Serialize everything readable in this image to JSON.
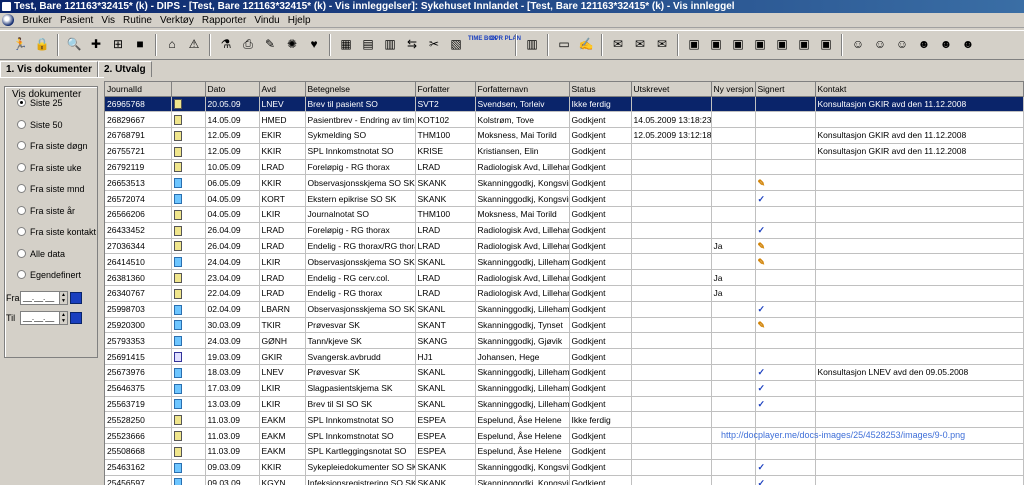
{
  "window": {
    "title": "Test, Bare  121163*32415* (k) - DIPS - [Test, Bare  121163*32415* (k) - Vis innleggelser]: Sykehuset Innlandet - [Test, Bare  121163*32415* (k) - Vis innleggel"
  },
  "menu": [
    "Bruker",
    "Pasient",
    "Vis",
    "Rutine",
    "Verktøy",
    "Rapporter",
    "Vindu",
    "Hjelp"
  ],
  "toolbar": {
    "groups": [
      [
        {
          "icon": "running-person-icon",
          "glyph": "🏃"
        },
        {
          "icon": "lock-icon",
          "glyph": "🔒"
        }
      ],
      [
        {
          "icon": "search-person-icon",
          "glyph": "🔍"
        },
        {
          "icon": "red-cross-icon",
          "glyph": "✚"
        },
        {
          "icon": "flowchart-icon",
          "glyph": "⊞"
        },
        {
          "icon": "book-icon",
          "glyph": "■"
        }
      ],
      [
        {
          "icon": "home-icon",
          "glyph": "⌂"
        },
        {
          "icon": "warning-icon",
          "glyph": "⚠"
        }
      ],
      [
        {
          "icon": "test-tube-icon",
          "glyph": "⚗"
        },
        {
          "icon": "printer-icon",
          "glyph": "⎙"
        },
        {
          "icon": "tool-icon",
          "glyph": "✎"
        },
        {
          "icon": "virus-icon",
          "glyph": "✺"
        },
        {
          "icon": "heart-icon",
          "glyph": "♥"
        }
      ],
      [
        {
          "icon": "forms-icon",
          "glyph": "▦"
        },
        {
          "icon": "forms-list-icon",
          "glyph": "▤"
        },
        {
          "icon": "forms-arrow-icon",
          "glyph": "▥"
        },
        {
          "icon": "forms-transfer-icon",
          "glyph": "⇆"
        },
        {
          "icon": "scissors-icon",
          "glyph": "✂"
        },
        {
          "icon": "folder-doc-icon",
          "glyph": "▧"
        },
        {
          "icon": "time-book-icon",
          "text": "TIME BOK"
        },
        {
          "icon": "opr-plan-icon",
          "text": "OPR PLAN"
        }
      ],
      [
        {
          "icon": "barcode-icon",
          "glyph": "▥"
        }
      ],
      [
        {
          "icon": "folder-icon",
          "glyph": "▭"
        },
        {
          "icon": "edit-doc-icon",
          "glyph": "✍"
        }
      ],
      [
        {
          "icon": "envelope-icon",
          "glyph": "✉"
        },
        {
          "icon": "envelope-pen-icon",
          "glyph": "✉"
        },
        {
          "icon": "envelope-plus-icon",
          "glyph": "✉"
        }
      ],
      [
        {
          "icon": "building-icon",
          "glyph": "▣"
        },
        {
          "icon": "building-list-icon",
          "glyph": "▣"
        },
        {
          "icon": "building-plus-icon",
          "glyph": "▣"
        },
        {
          "icon": "building-doc-icon",
          "glyph": "▣"
        },
        {
          "icon": "buildings-icon",
          "glyph": "▣"
        },
        {
          "icon": "buildings-arrow-icon",
          "glyph": "▣"
        },
        {
          "icon": "buildings-group-icon",
          "glyph": "▣"
        }
      ],
      [
        {
          "icon": "person-doc-icon",
          "glyph": "☺"
        },
        {
          "icon": "person-list-icon",
          "glyph": "☺"
        },
        {
          "icon": "person-plus-icon",
          "glyph": "☺"
        },
        {
          "icon": "persons-icon",
          "glyph": "☻"
        },
        {
          "icon": "persons-group-icon",
          "glyph": "☻"
        },
        {
          "icon": "persons-link-icon",
          "glyph": "☻"
        }
      ]
    ]
  },
  "tabs": [
    {
      "label": "1. Vis dokumenter",
      "active": true
    },
    {
      "label": "2. Utvalg",
      "active": false
    }
  ],
  "filter": {
    "group_title": "Vis dokumenter",
    "options": [
      {
        "label": "Siste 25",
        "checked": true
      },
      {
        "label": "Siste 50",
        "checked": false
      },
      {
        "label": "Fra siste døgn",
        "checked": false
      },
      {
        "label": "Fra siste uke",
        "checked": false
      },
      {
        "label": "Fra siste mnd",
        "checked": false
      },
      {
        "label": "Fra siste år",
        "checked": false
      },
      {
        "label": "Fra siste kontakt",
        "checked": false
      },
      {
        "label": "Alle data",
        "checked": false
      },
      {
        "label": "Egendefinert",
        "checked": false
      }
    ],
    "from_label": "Fra",
    "to_label": "Til",
    "from_value": "__.__.__",
    "to_value": "__.__.__"
  },
  "table": {
    "columns": [
      "JournalId",
      "",
      "Dato",
      "Avd",
      "Betegnelse",
      "Forfatter",
      "Forfatternavn",
      "Status",
      "Utskrevet",
      "Ny versjon",
      "Signert",
      "Kontakt"
    ],
    "rows": [
      {
        "id": "26965768",
        "icon": "doc",
        "date": "20.05.09",
        "avd": "LNEV",
        "title": "Brev til pasient SO",
        "author": "SVT2",
        "author_name": "Svendsen, Torleiv",
        "status": "Ikke ferdig",
        "printed": "",
        "new_version": "",
        "signed": "",
        "contact": "Konsultasjon GKIR avd den 11.12.2008",
        "selected": true
      },
      {
        "id": "26829667",
        "icon": "doc",
        "date": "14.05.09",
        "avd": "HMED",
        "title": "Pasientbrev - Endring av tim",
        "author": "KOT102",
        "author_name": "Kolstrøm, Tove",
        "status": "Godkjent",
        "printed": "14.05.2009 13:18:23",
        "new_version": "",
        "signed": "",
        "contact": ""
      },
      {
        "id": "26768791",
        "icon": "doc",
        "date": "12.05.09",
        "avd": "EKIR",
        "title": "Sykmelding SO",
        "author": "THM100",
        "author_name": "Moksness, Mai Torild",
        "status": "Godkjent",
        "printed": "12.05.2009 13:12:18",
        "new_version": "",
        "signed": "",
        "contact": "Konsultasjon GKIR avd den 11.12.2008"
      },
      {
        "id": "26755721",
        "icon": "doc",
        "date": "12.05.09",
        "avd": "KKIR",
        "title": "SPL Innkomstnotat SO",
        "author": "KRISE",
        "author_name": "Kristiansen, Elin",
        "status": "Godkjent",
        "printed": "",
        "new_version": "",
        "signed": "",
        "contact": "Konsultasjon GKIR avd den 11.12.2008"
      },
      {
        "id": "26792119",
        "icon": "doc",
        "date": "10.05.09",
        "avd": "LRAD",
        "title": "Foreløpig - RG thorax",
        "author": "LRAD",
        "author_name": "Radiologisk Avd, Lillehammer",
        "status": "Godkjent",
        "printed": "",
        "new_version": "",
        "signed": "",
        "contact": ""
      },
      {
        "id": "26653513",
        "icon": "person",
        "date": "06.05.09",
        "avd": "KKIR",
        "title": "Observasjonsskjema  SO SK",
        "author": "SKANK",
        "author_name": "Skanninggodkj, Kongsvinger",
        "status": "Godkjent",
        "printed": "",
        "new_version": "",
        "signed": "pen",
        "contact": ""
      },
      {
        "id": "26572074",
        "icon": "person",
        "date": "04.05.09",
        "avd": "KORT",
        "title": "Ekstern epikrise SO SK",
        "author": "SKANK",
        "author_name": "Skanninggodkj, Kongsvinger",
        "status": "Godkjent",
        "printed": "",
        "new_version": "",
        "signed": "check",
        "contact": ""
      },
      {
        "id": "26566206",
        "icon": "doc",
        "date": "04.05.09",
        "avd": "LKIR",
        "title": "Journalnotat SO",
        "author": "THM100",
        "author_name": "Moksness, Mai Torild",
        "status": "Godkjent",
        "printed": "",
        "new_version": "",
        "signed": "",
        "contact": ""
      },
      {
        "id": "26433452",
        "icon": "doc",
        "date": "26.04.09",
        "avd": "LRAD",
        "title": "Foreløpig - RG thorax",
        "author": "LRAD",
        "author_name": "Radiologisk Avd, Lillehammer",
        "status": "Godkjent",
        "printed": "",
        "new_version": "",
        "signed": "check",
        "contact": ""
      },
      {
        "id": "27036344",
        "icon": "doc",
        "date": "26.04.09",
        "avd": "LRAD",
        "title": "Endelig - RG thorax/RG thorax",
        "author": "LRAD",
        "author_name": "Radiologisk Avd, Lillehammer",
        "status": "Godkjent",
        "printed": "",
        "new_version": "Ja",
        "signed": "pen",
        "contact": ""
      },
      {
        "id": "26414510",
        "icon": "person",
        "date": "24.04.09",
        "avd": "LKIR",
        "title": "Observasjonsskjema  SO SK",
        "author": "SKANL",
        "author_name": "Skanninggodkj, Lillehammer",
        "status": "Godkjent",
        "printed": "",
        "new_version": "",
        "signed": "pen",
        "contact": ""
      },
      {
        "id": "26381360",
        "icon": "doc",
        "date": "23.04.09",
        "avd": "LRAD",
        "title": "Endelig -  RG cerv.col.",
        "author": "LRAD",
        "author_name": "Radiologisk Avd, Lillehammer",
        "status": "Godkjent",
        "printed": "",
        "new_version": "Ja",
        "signed": "",
        "contact": ""
      },
      {
        "id": "26340767",
        "icon": "doc",
        "date": "22.04.09",
        "avd": "LRAD",
        "title": "Endelig - RG thorax",
        "author": "LRAD",
        "author_name": "Radiologisk Avd, Lillehammer",
        "status": "Godkjent",
        "printed": "",
        "new_version": "Ja",
        "signed": "",
        "contact": ""
      },
      {
        "id": "25998703",
        "icon": "person",
        "date": "02.04.09",
        "avd": "LBARN",
        "title": "Observasjonsskjema  SO SK",
        "author": "SKANL",
        "author_name": "Skanninggodkj, Lillehammer",
        "status": "Godkjent",
        "printed": "",
        "new_version": "",
        "signed": "check",
        "contact": ""
      },
      {
        "id": "25920300",
        "icon": "person",
        "date": "30.03.09",
        "avd": "TKIR",
        "title": "Prøvesvar SK",
        "author": "SKANT",
        "author_name": "Skanninggodkj, Tynset",
        "status": "Godkjent",
        "printed": "",
        "new_version": "",
        "signed": "pen",
        "contact": ""
      },
      {
        "id": "25793353",
        "icon": "person",
        "date": "24.03.09",
        "avd": "GØNH",
        "title": "Tann/kjeve SK",
        "author": "SKANG",
        "author_name": "Skanninggodkj, Gjøvik",
        "status": "Godkjent",
        "printed": "",
        "new_version": "",
        "signed": "",
        "contact": ""
      },
      {
        "id": "25691415",
        "icon": "hospital",
        "date": "19.03.09",
        "avd": "GKIR",
        "title": "Svangersk.avbrudd",
        "author": "HJ1",
        "author_name": "Johansen, Hege",
        "status": "Godkjent",
        "printed": "",
        "new_version": "",
        "signed": "",
        "contact": ""
      },
      {
        "id": "25673976",
        "icon": "person",
        "date": "18.03.09",
        "avd": "LNEV",
        "title": "Prøvesvar SK",
        "author": "SKANL",
        "author_name": "Skanninggodkj, Lillehammer",
        "status": "Godkjent",
        "printed": "",
        "new_version": "",
        "signed": "check",
        "contact": "Konsultasjon LNEV avd den 09.05.2008"
      },
      {
        "id": "25646375",
        "icon": "person",
        "date": "17.03.09",
        "avd": "LKIR",
        "title": "Slagpasientskjema SK",
        "author": "SKANL",
        "author_name": "Skanninggodkj, Lillehammer",
        "status": "Godkjent",
        "printed": "",
        "new_version": "",
        "signed": "check",
        "contact": ""
      },
      {
        "id": "25563719",
        "icon": "person",
        "date": "13.03.09",
        "avd": "LKIR",
        "title": "Brev til SI SO SK",
        "author": "SKANL",
        "author_name": "Skanninggodkj, Lillehammer",
        "status": "Godkjent",
        "printed": "",
        "new_version": "",
        "signed": "check",
        "contact": ""
      },
      {
        "id": "25528250",
        "icon": "doc",
        "date": "11.03.09",
        "avd": "EAKM",
        "title": "SPL Innkomstnotat SO",
        "author": "ESPEA",
        "author_name": "Espelund, Åse Helene",
        "status": "Ikke ferdig",
        "printed": "",
        "new_version": "",
        "signed": "",
        "contact": ""
      },
      {
        "id": "25523666",
        "icon": "doc",
        "date": "11.03.09",
        "avd": "EAKM",
        "title": "SPL Innkomstnotat SO",
        "author": "ESPEA",
        "author_name": "Espelund, Åse Helene",
        "status": "Godkjent",
        "printed": "",
        "new_version": "",
        "signed": "",
        "contact": ""
      },
      {
        "id": "25508668",
        "icon": "doc",
        "date": "11.03.09",
        "avd": "EAKM",
        "title": "SPL Kartleggingsnotat SO",
        "author": "ESPEA",
        "author_name": "Espelund, Åse Helene",
        "status": "Godkjent",
        "printed": "",
        "new_version": "",
        "signed": "",
        "contact": ""
      },
      {
        "id": "25463162",
        "icon": "person",
        "date": "09.03.09",
        "avd": "KKIR",
        "title": "Sykepleiedokumenter SO SK",
        "author": "SKANK",
        "author_name": "Skanninggodkj, Kongsvinger",
        "status": "Godkjent",
        "printed": "",
        "new_version": "",
        "signed": "check",
        "contact": ""
      },
      {
        "id": "25456597",
        "icon": "person",
        "date": "09.03.09",
        "avd": "KGYN",
        "title": "Infeksjonsregistrering SO SK",
        "author": "SKANK",
        "author_name": "Skanninggodkj, Kongsvinger",
        "status": "Godkjent",
        "printed": "",
        "new_version": "",
        "signed": "check",
        "contact": ""
      }
    ]
  },
  "watermark": "http://docplayer.me/docs-images/25/4528253/images/9-0.png"
}
